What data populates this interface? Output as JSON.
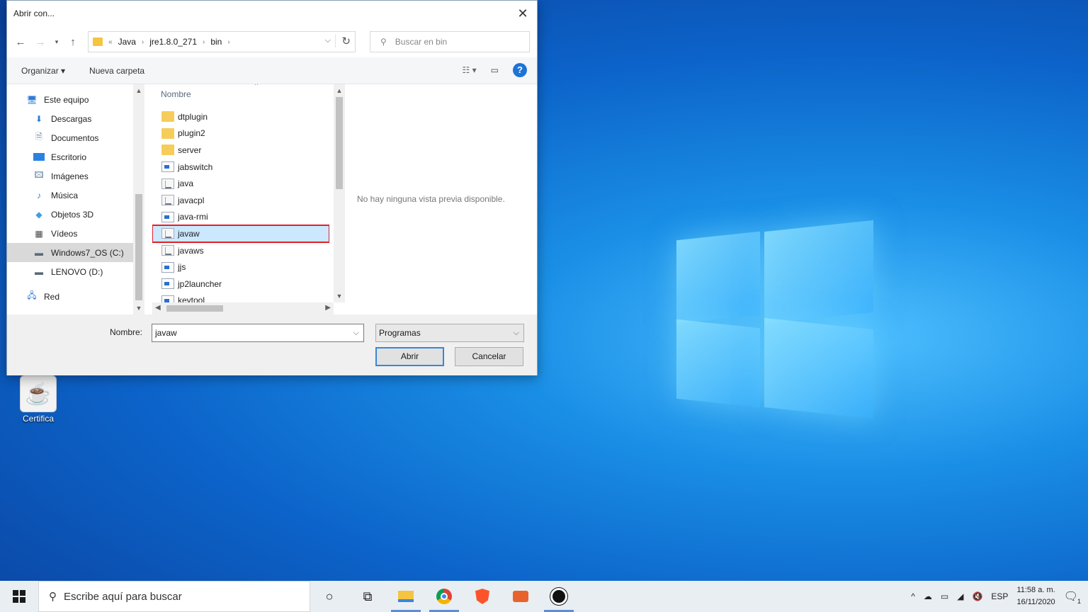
{
  "desktop": {
    "icon_label": "Certifica"
  },
  "dialog": {
    "title": "Abrir con...",
    "close_glyph": "✕",
    "breadcrumb": [
      "Java",
      "jre1.8.0_271",
      "bin"
    ],
    "search_placeholder": "Buscar en bin",
    "toolbar": {
      "organize": "Organizar ▾",
      "new_folder": "Nueva carpeta"
    },
    "nav_items": [
      {
        "label": "Este equipo",
        "icon": "computer-icon"
      },
      {
        "label": "Descargas",
        "icon": "download-icon"
      },
      {
        "label": "Documentos",
        "icon": "documents-icon"
      },
      {
        "label": "Escritorio",
        "icon": "desktop-icon"
      },
      {
        "label": "Imágenes",
        "icon": "pictures-icon"
      },
      {
        "label": "Música",
        "icon": "music-icon"
      },
      {
        "label": "Objetos 3D",
        "icon": "3d-objects-icon"
      },
      {
        "label": "Vídeos",
        "icon": "videos-icon"
      },
      {
        "label": "Windows7_OS (C:)",
        "icon": "drive-icon"
      },
      {
        "label": "LENOVO (D:)",
        "icon": "drive-icon"
      },
      {
        "label": "Red",
        "icon": "network-icon"
      }
    ],
    "column_header": "Nombre",
    "files": [
      {
        "name": "dtplugin",
        "type": "folder"
      },
      {
        "name": "plugin2",
        "type": "folder"
      },
      {
        "name": "server",
        "type": "folder"
      },
      {
        "name": "jabswitch",
        "type": "exe"
      },
      {
        "name": "java",
        "type": "java"
      },
      {
        "name": "javacpl",
        "type": "java"
      },
      {
        "name": "java-rmi",
        "type": "exe"
      },
      {
        "name": "javaw",
        "type": "java",
        "selected": true
      },
      {
        "name": "javaws",
        "type": "java"
      },
      {
        "name": "jjs",
        "type": "exe"
      },
      {
        "name": "jp2launcher",
        "type": "exe"
      },
      {
        "name": "keytool",
        "type": "exe"
      }
    ],
    "preview_text": "No hay ninguna vista previa disponible.",
    "name_label": "Nombre:",
    "name_value": "javaw",
    "file_type": "Programas",
    "open_button": "Abrir",
    "cancel_button": "Cancelar"
  },
  "taskbar": {
    "search_placeholder": "Escribe aquí para buscar",
    "language": "ESP",
    "time": "11:58 a. m.",
    "date": "16/11/2020",
    "notification_count": "1"
  },
  "colors": {
    "selection_outline": "#e0202c",
    "selection_fill": "#cce8ff",
    "accent": "#1e73d8"
  }
}
